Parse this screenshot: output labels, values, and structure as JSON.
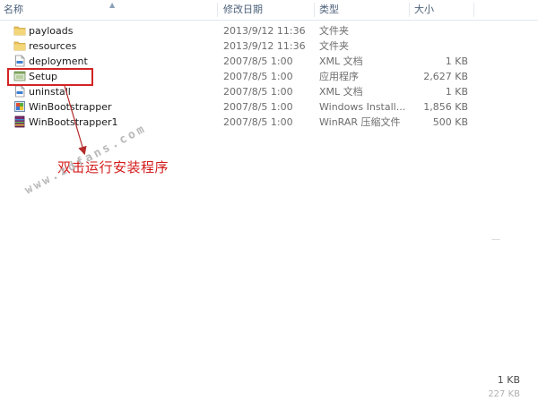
{
  "columns": {
    "name": "名称",
    "date_modified": "修改日期",
    "type": "类型",
    "size": "大小"
  },
  "files": [
    {
      "name": "payloads",
      "date": "2013/9/12 11:36",
      "type": "文件夹",
      "size": "",
      "icon": "folder-icon"
    },
    {
      "name": "resources",
      "date": "2013/9/12 11:36",
      "type": "文件夹",
      "size": "",
      "icon": "folder-icon"
    },
    {
      "name": "deployment",
      "date": "2007/8/5 1:00",
      "type": "XML 文档",
      "size": "1 KB",
      "icon": "xml-file-icon"
    },
    {
      "name": "Setup",
      "date": "2007/8/5 1:00",
      "type": "应用程序",
      "size": "2,627 KB",
      "icon": "setup-app-icon"
    },
    {
      "name": "uninstall",
      "date": "2007/8/5 1:00",
      "type": "XML 文档",
      "size": "1 KB",
      "icon": "xml-file-icon"
    },
    {
      "name": "WinBootstrapper",
      "date": "2007/8/5 1:00",
      "type": "Windows Install...",
      "size": "1,856 KB",
      "icon": "installer-file-icon"
    },
    {
      "name": "WinBootstrapper1",
      "date": "2007/8/5 1:00",
      "type": "WinRAR 压缩文件",
      "size": "500 KB",
      "icon": "winrar-archive-icon"
    }
  ],
  "annotation": {
    "text": "双击运行安装程序",
    "color": "#d31a1a"
  },
  "watermark": "www.zdfans.com",
  "footer": {
    "selected_size": "1 KB",
    "partial_text": "227 KB"
  },
  "faint_edge_text": "—"
}
